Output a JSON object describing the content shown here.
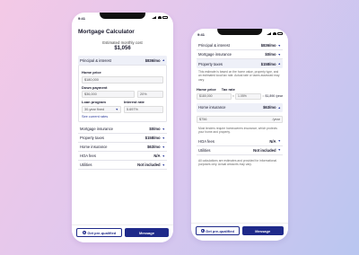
{
  "status_time": "9:41",
  "screen1": {
    "title": "Mortgage Calculator",
    "estimate_label": "Estimated monthly cost",
    "estimate_value": "$1,056",
    "principal_row": {
      "label": "Principal & interest",
      "value": "$836/mo"
    },
    "home_price": {
      "label": "Home price",
      "value": "$180,000"
    },
    "down_payment": {
      "label": "Down payment",
      "value": "$36,000",
      "percent": "20%"
    },
    "loan_program": {
      "label": "Loan program",
      "value": "30-year fixed"
    },
    "interest_rate": {
      "label": "Interest rate",
      "value": "5.697%"
    },
    "see_rates": "See current rates",
    "rows": [
      {
        "label": "Mortgage insurance",
        "value": "$0/mo"
      },
      {
        "label": "Property taxes",
        "value": "$158/mo"
      },
      {
        "label": "Home insurance",
        "value": "$63/mo"
      },
      {
        "label": "HOA fees",
        "value": "N/A"
      },
      {
        "label": "Utilities",
        "value": "Not included"
      }
    ]
  },
  "screen2": {
    "rows_top": [
      {
        "label": "Principal & interest",
        "value": "$836/mo"
      },
      {
        "label": "Mortgage insurance",
        "value": "$0/mo"
      }
    ],
    "property_taxes": {
      "label": "Property taxes",
      "value": "$158/mo"
    },
    "tax_note": "This estimate is based on the home value, property type, and an estimated local tax rate. Actual rate or taxes assessed may vary.",
    "home_price_label": "Home price",
    "tax_rate_label": "Tax rate",
    "calc": {
      "home_price": "$180,000",
      "times": "×",
      "rate": "1.05%",
      "equals": "=",
      "result": "$1,890 /year"
    },
    "home_insurance": {
      "label": "Home insurance",
      "value": "$63/mo"
    },
    "insurance_amount": "$756",
    "insurance_unit": "/year",
    "insurance_note": "Most lenders require homeowners insurance, which protects your home and property.",
    "rows_bottom": [
      {
        "label": "HOA fees",
        "value": "N/A"
      },
      {
        "label": "Utilities",
        "value": "Not included"
      }
    ],
    "disclaimer": "All calculations are estimates and provided for informational purposes only. Actual amounts may vary."
  },
  "buttons": {
    "prequalify": "Get pre-qualified",
    "message": "Message"
  },
  "colors": {
    "accent": "#1f2a8a",
    "link": "#2b3a9a"
  }
}
